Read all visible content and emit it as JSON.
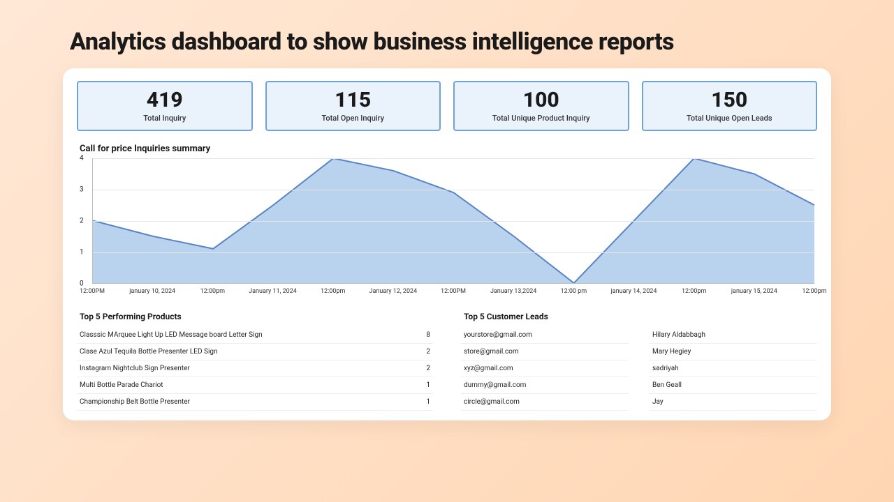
{
  "page_title": "Analytics dashboard to show business intelligence reports",
  "stats": [
    {
      "value": "419",
      "label": "Total Inquiry"
    },
    {
      "value": "115",
      "label": "Total Open Inquiry"
    },
    {
      "value": "100",
      "label": "Total Unique Product Inquiry"
    },
    {
      "value": "150",
      "label": "Total Unique Open Leads"
    }
  ],
  "chart_title": "Call for price Inquiries summary",
  "chart_data": {
    "type": "area",
    "categories": [
      "12:00PM",
      "january 10, 2024",
      "12:00pm",
      "January 11, 2024",
      "12:00pm",
      "January 12, 2024",
      "12:00PM",
      "January 13,2024",
      "12:00 pm",
      "january 14, 2024",
      "12:00pm",
      "january 15, 2024",
      "12:00pm"
    ],
    "values": [
      2.0,
      1.5,
      1.1,
      2.5,
      4.0,
      3.6,
      2.9,
      1.5,
      0.0,
      2.0,
      4.0,
      3.5,
      2.5
    ],
    "title": "Call for price Inquiries summary",
    "xlabel": "",
    "ylabel": "",
    "ylim": [
      0,
      4
    ],
    "yticks": [
      0,
      1,
      2,
      3,
      4
    ],
    "fill": "#b9d3ef",
    "stroke": "#5a84c4"
  },
  "products_title": "Top 5 Performing Products",
  "products": [
    {
      "name": "Classsic MArquee Light Up LED Message board Letter Sign",
      "count": "8"
    },
    {
      "name": "Clase Azul Tequila Bottle Presenter LED Sign",
      "count": "2"
    },
    {
      "name": "Instagram Nightclub Sign Presenter",
      "count": "2"
    },
    {
      "name": " Multi Bottle Parade Chariot",
      "count": "1"
    },
    {
      "name": "Championship Belt Bottle Presenter",
      "count": "1"
    }
  ],
  "leads_title": "Top 5 Customer Leads",
  "leads_emails": [
    "yourstore@gmail.com",
    "store@gmail.com",
    "xyz@gmail.com",
    "dummy@gmail.com",
    "circle@gmail.com"
  ],
  "leads_names": [
    "Hilary Aldabbagh",
    "Mary Hegiey",
    "sadriyah",
    "Ben Geall",
    "Jay"
  ]
}
